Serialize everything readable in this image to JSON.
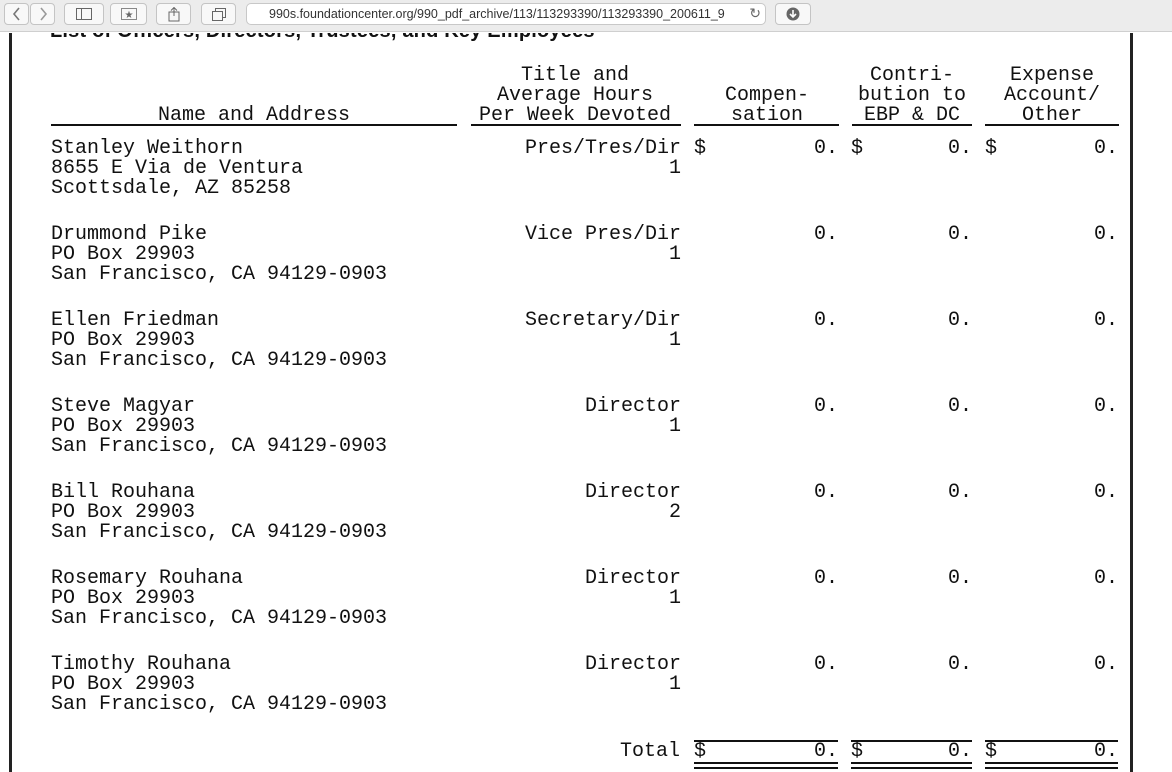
{
  "browser": {
    "url": "990s.foundationcenter.org/990_pdf_archive/113/113293390/113293390_200611_9",
    "back_icon": "chevron-left-icon",
    "forward_icon": "chevron-right-icon"
  },
  "document": {
    "heading": "List of Officers, Directors, Trustees, and Key Employees",
    "columns": {
      "name": "Name and Address",
      "title_line1": "Title and",
      "title_line2": "Average Hours",
      "title_line3": "Per Week Devoted",
      "comp_line1": "Compen-",
      "comp_line2": "sation",
      "contrib_line1": "Contri-",
      "contrib_line2": "bution to",
      "contrib_line3": "EBP & DC",
      "expense_line1": "Expense",
      "expense_line2": "Account/",
      "expense_line3": "Other"
    },
    "rows": [
      {
        "name": "Stanley Weithorn",
        "addr1": "8655 E Via de Ventura",
        "addr2": "Scottsdale, AZ 85258",
        "title": "Pres/Tres/Dir",
        "hours": "1",
        "comp": "0.",
        "contrib": "0.",
        "expense": "0."
      },
      {
        "name": "Drummond Pike",
        "addr1": "PO Box 29903",
        "addr2": "San Francisco, CA 94129-0903",
        "title": "Vice Pres/Dir",
        "hours": "1",
        "comp": "0.",
        "contrib": "0.",
        "expense": "0."
      },
      {
        "name": "Ellen Friedman",
        "addr1": "PO Box 29903",
        "addr2": "San Francisco, CA 94129-0903",
        "title": "Secretary/Dir",
        "hours": "1",
        "comp": "0.",
        "contrib": "0.",
        "expense": "0."
      },
      {
        "name": "Steve Magyar",
        "addr1": "PO Box 29903",
        "addr2": "San Francisco, CA 94129-0903",
        "title": "Director",
        "hours": "1",
        "comp": "0.",
        "contrib": "0.",
        "expense": "0."
      },
      {
        "name": "Bill Rouhana",
        "addr1": "PO Box 29903",
        "addr2": "San Francisco, CA 94129-0903",
        "title": "Director",
        "hours": "2",
        "comp": "0.",
        "contrib": "0.",
        "expense": "0."
      },
      {
        "name": "Rosemary Rouhana",
        "addr1": "PO Box 29903",
        "addr2": "San Francisco, CA 94129-0903",
        "title": "Director",
        "hours": "1",
        "comp": "0.",
        "contrib": "0.",
        "expense": "0."
      },
      {
        "name": "Timothy Rouhana",
        "addr1": "PO Box 29903",
        "addr2": "San Francisco, CA 94129-0903",
        "title": "Director",
        "hours": "1",
        "comp": "0.",
        "contrib": "0.",
        "expense": "0."
      }
    ],
    "dollar": "$",
    "total_label": "Total",
    "total_comp": "0.",
    "total_contrib": "0.",
    "total_expense": "0."
  }
}
